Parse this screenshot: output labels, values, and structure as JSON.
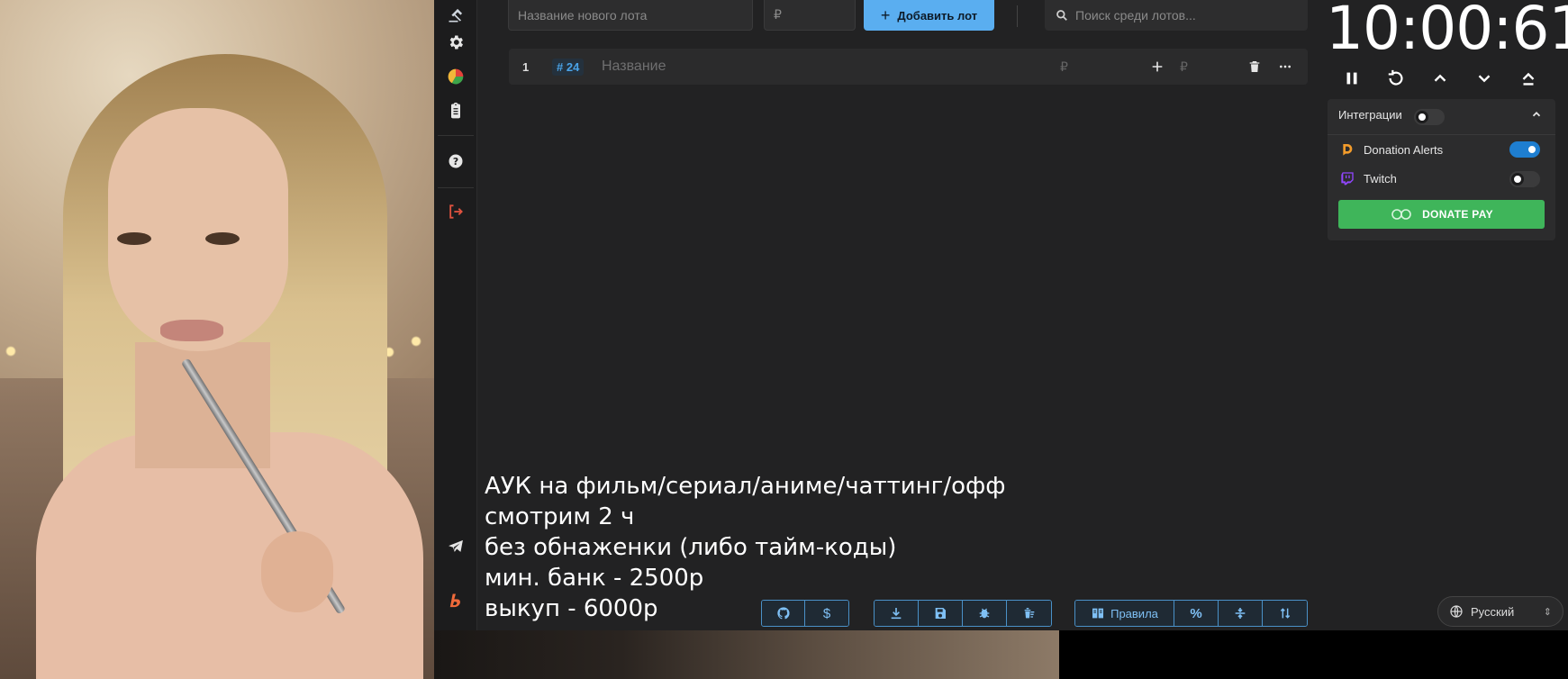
{
  "sidebar": {
    "items": [
      {
        "name": "auction-icon"
      },
      {
        "name": "settings-icon"
      },
      {
        "name": "stats-pie-icon"
      },
      {
        "name": "clipboard-icon"
      },
      {
        "name": "help-icon"
      },
      {
        "name": "logout-icon"
      },
      {
        "name": "telegram-icon"
      },
      {
        "name": "boosty-icon"
      }
    ]
  },
  "toolbar": {
    "new_lot_placeholder": "Название нового лота",
    "currency_placeholder": "₽",
    "add_lot_label": "Добавить лот",
    "search_placeholder": "Поиск среди лотов..."
  },
  "lots": [
    {
      "index": "1",
      "tag": "# 24",
      "name_placeholder": "Название",
      "currency": "₽",
      "add_currency": "₽"
    }
  ],
  "timer": {
    "display": "10:00:61"
  },
  "integrations": {
    "title": "Интеграции",
    "enabled": false,
    "items": [
      {
        "label": "Donation Alerts",
        "enabled": true,
        "icon": "donation-alerts-icon"
      },
      {
        "label": "Twitch",
        "enabled": false,
        "icon": "twitch-icon"
      }
    ],
    "donatepay_label": "DONATE PAY"
  },
  "overlay_text": {
    "line1": "АУК на фильм/сериал/аниме/чаттинг/офф",
    "line2": "смотрим 2 ч",
    "line3": "без обнаженки (либо тайм-коды)",
    "line4": "мин. банк - 2500р",
    "line5": "выкуп - 6000р"
  },
  "bottom_toolbar": {
    "rules_label": "Правила"
  },
  "language": {
    "selected": "Русский"
  },
  "colors": {
    "accent": "#5aaef0",
    "toggle_on": "#1e7ed0",
    "donatepay": "#3fb55a",
    "logout": "#e0523f",
    "toolbar_text": "#7fc0f5"
  }
}
